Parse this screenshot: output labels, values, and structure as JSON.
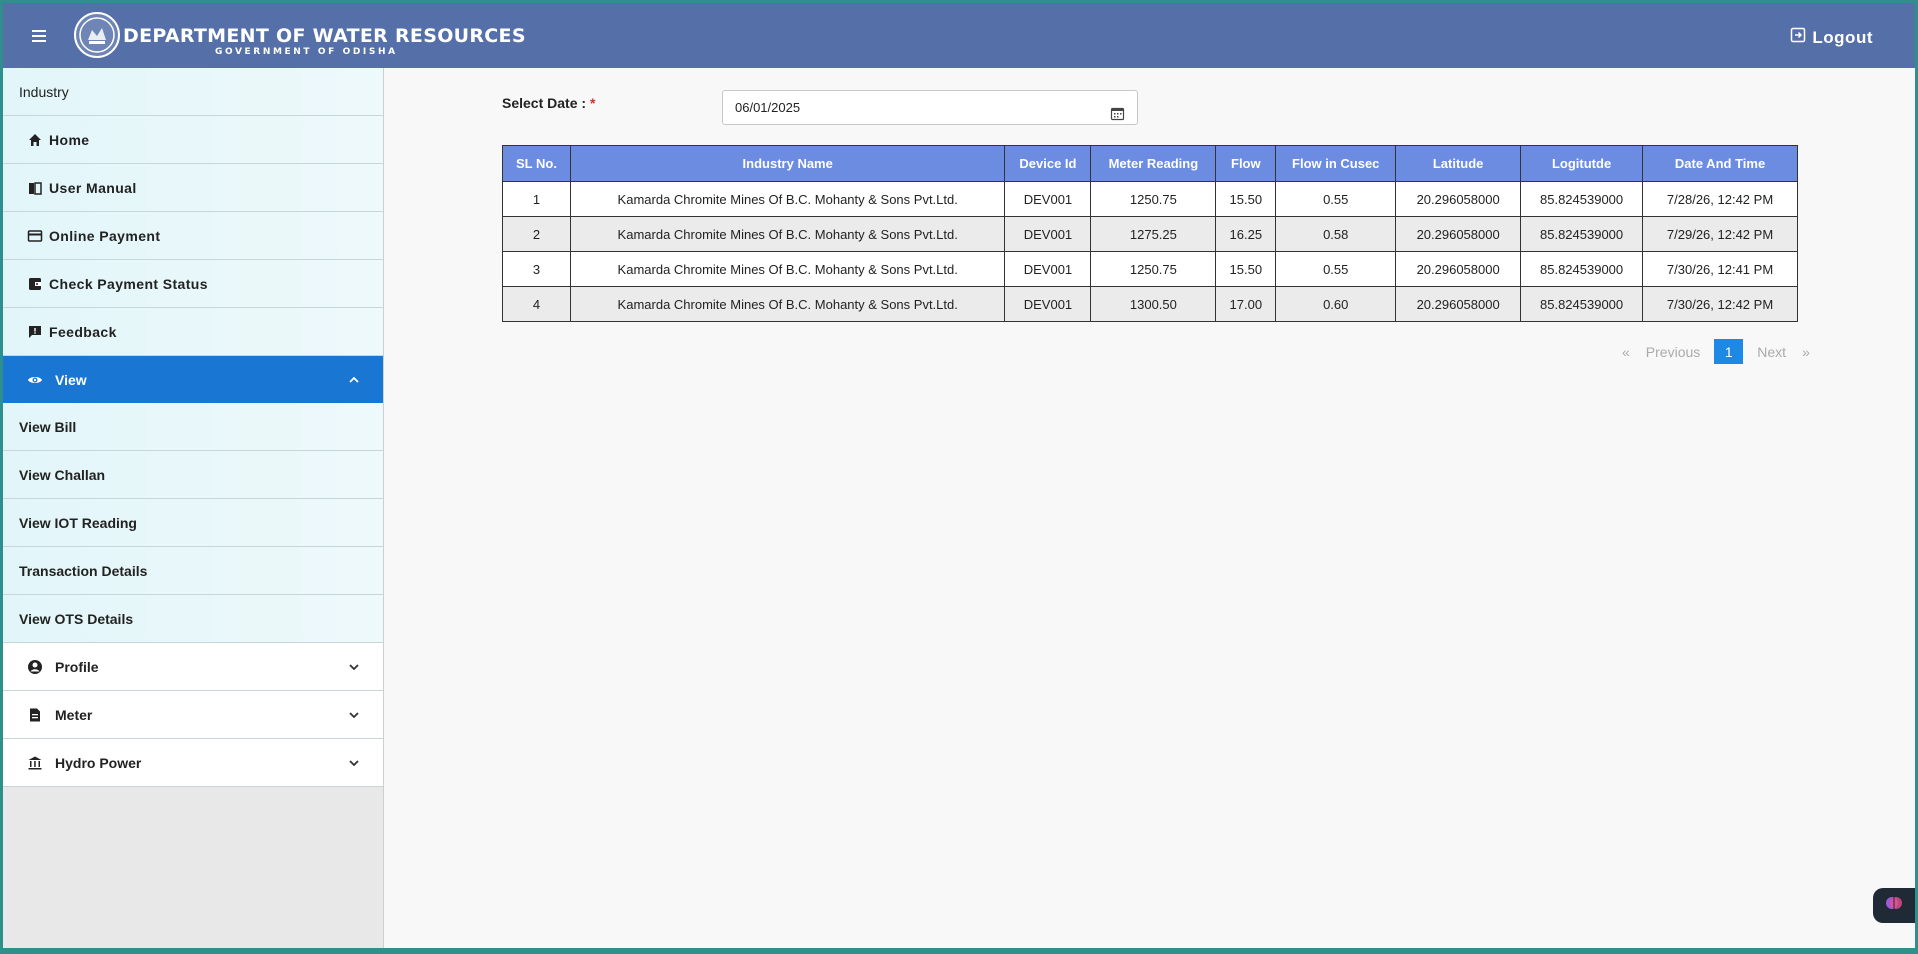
{
  "header": {
    "title": "DEPARTMENT OF WATER RESOURCES",
    "subtitle": "GOVERNMENT OF ODISHA",
    "logout_label": "Logout",
    "color": "#5570a8"
  },
  "sidebar": {
    "section_label": "Industry",
    "items": [
      {
        "label": "Home",
        "icon": "home-icon"
      },
      {
        "label": "User Manual",
        "icon": "book-icon"
      },
      {
        "label": "Online Payment",
        "icon": "credit-card-icon"
      },
      {
        "label": "Check Payment Status",
        "icon": "wallet-icon"
      },
      {
        "label": "Feedback",
        "icon": "feedback-icon"
      }
    ],
    "view": {
      "label": "View",
      "icon": "eye-icon",
      "color": "#1976d2"
    },
    "view_children": [
      "View Bill",
      "View Challan",
      "View IOT Reading",
      "Transaction Details",
      "View OTS Details"
    ],
    "groups": [
      {
        "label": "Profile",
        "icon": "account-circle-icon"
      },
      {
        "label": "Meter",
        "icon": "document-icon"
      },
      {
        "label": "Hydro Power",
        "icon": "bank-icon"
      }
    ]
  },
  "filter": {
    "label": "Select Date :",
    "required_mark": "*",
    "date_value": "06/01/2025"
  },
  "table": {
    "columns": [
      "SL No.",
      "Industry Name",
      "Device Id",
      "Meter Reading",
      "Flow",
      "Flow in Cusec",
      "Latitude",
      "Logitutde",
      "Date And Time"
    ],
    "rows": [
      [
        "1",
        "Kamarda Chromite Mines Of B.C. Mohanty & Sons Pvt.Ltd.",
        "DEV001",
        "1250.75",
        "15.50",
        "0.55",
        "20.296058000",
        "85.824539000",
        "7/28/26, 12:42 PM"
      ],
      [
        "2",
        "Kamarda Chromite Mines Of B.C. Mohanty & Sons Pvt.Ltd.",
        "DEV001",
        "1275.25",
        "16.25",
        "0.58",
        "20.296058000",
        "85.824539000",
        "7/29/26, 12:42 PM"
      ],
      [
        "3",
        "Kamarda Chromite Mines Of B.C. Mohanty & Sons Pvt.Ltd.",
        "DEV001",
        "1250.75",
        "15.50",
        "0.55",
        "20.296058000",
        "85.824539000",
        "7/30/26, 12:41 PM"
      ],
      [
        "4",
        "Kamarda Chromite Mines Of B.C. Mohanty & Sons Pvt.Ltd.",
        "DEV001",
        "1300.50",
        "17.00",
        "0.60",
        "20.296058000",
        "85.824539000",
        "7/30/26, 12:42 PM"
      ]
    ],
    "header_color": "#6b8ce0"
  },
  "pagination": {
    "first": "«",
    "previous": "Previous",
    "current": "1",
    "next": "Next",
    "last": "»"
  }
}
